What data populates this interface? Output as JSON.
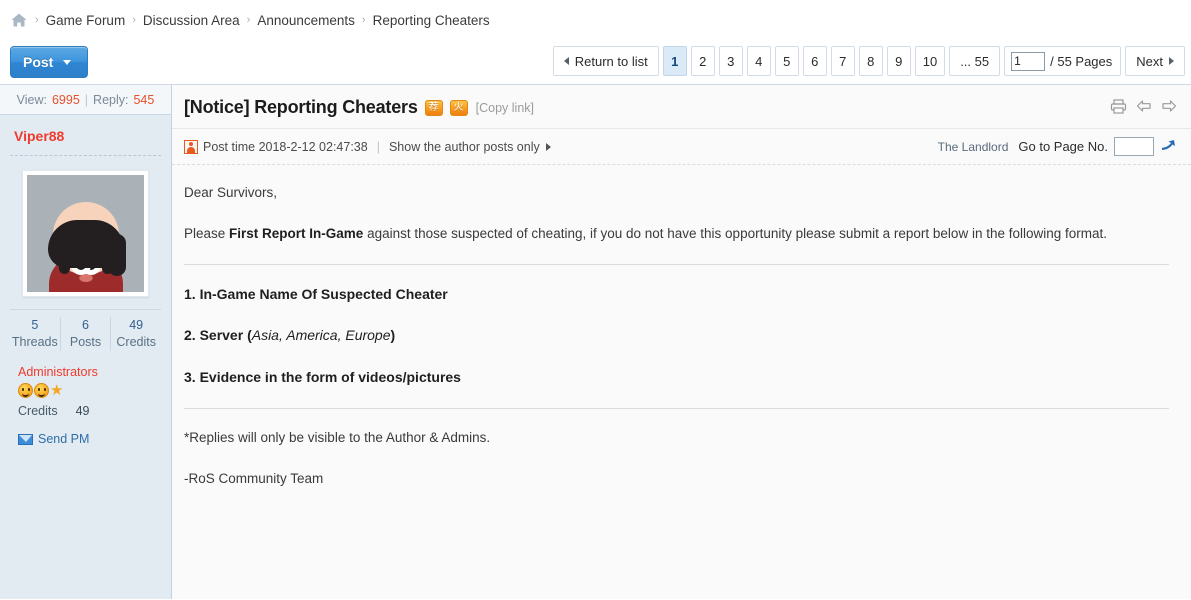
{
  "breadcrumb": {
    "home_icon": "home-icon",
    "separator": "›",
    "items": [
      {
        "label": "Game Forum"
      },
      {
        "label": "Discussion Area"
      },
      {
        "label": "Announcements"
      },
      {
        "label": "Reporting Cheaters"
      }
    ]
  },
  "toolbar": {
    "post_label": "Post"
  },
  "pagination": {
    "return_label": "Return to list",
    "pages": [
      "1",
      "2",
      "3",
      "4",
      "5",
      "6",
      "7",
      "8",
      "9",
      "10"
    ],
    "current_page": "1",
    "ellipsis_last": "... 55",
    "jump_value": "1",
    "jump_suffix": "/ 55 Pages",
    "next_label": "Next"
  },
  "sidebar": {
    "view_label": "View:",
    "view_count": "6995",
    "reply_label": "Reply:",
    "reply_count": "545",
    "username": "Viper88",
    "avatar_alt": "user-avatar",
    "stats": [
      {
        "value": "5",
        "label": "Threads"
      },
      {
        "value": "6",
        "label": "Posts"
      },
      {
        "value": "49",
        "label": "Credits"
      }
    ],
    "group": "Administrators",
    "medals": [
      "smiley-medal",
      "smiley-medal",
      "star-medal"
    ],
    "credits_label": "Credits",
    "credits_value": "49",
    "send_pm_label": "Send PM"
  },
  "post": {
    "title": "[Notice] Reporting Cheaters",
    "badges": [
      {
        "name": "recommended-badge",
        "glyph": "荐"
      },
      {
        "name": "hot-badge",
        "glyph": "火"
      }
    ],
    "copy_link_label": "[Copy link]",
    "actions": [
      "print-icon",
      "prev-post-icon",
      "next-post-icon"
    ],
    "post_time_label": "Post time 2018-2-12 02:47:38",
    "author_only_label": "Show the author posts only",
    "landlord_label": "The Landlord",
    "goto_page_label": "Go to Page No.",
    "goto_page_value": "",
    "body": {
      "greeting": "Dear Survivors,",
      "intro_pre": "Please ",
      "intro_bold": "First Report In-Game",
      "intro_post": " against those suspected of cheating, if you do not have this opportunity please submit a report below in the following format.",
      "item1": "1. In-Game Name Of Suspected Cheater",
      "item2_main": "2. Server ",
      "item2_paren_open": "(",
      "item2_italic": "Asia, America, Europe",
      "item2_paren_close": ")",
      "item3": "3. Evidence in the form of videos/pictures",
      "note": "*Replies will only be visible to the Author & Admins.",
      "signature": "-RoS Community Team"
    }
  },
  "colors": {
    "accent_blue": "#2f7fc9",
    "alert_red": "#ef3b2d",
    "count_orange": "#e8502a",
    "sidebar_bg": "#e2eaf2",
    "badge_orange": "#f79b1f"
  }
}
